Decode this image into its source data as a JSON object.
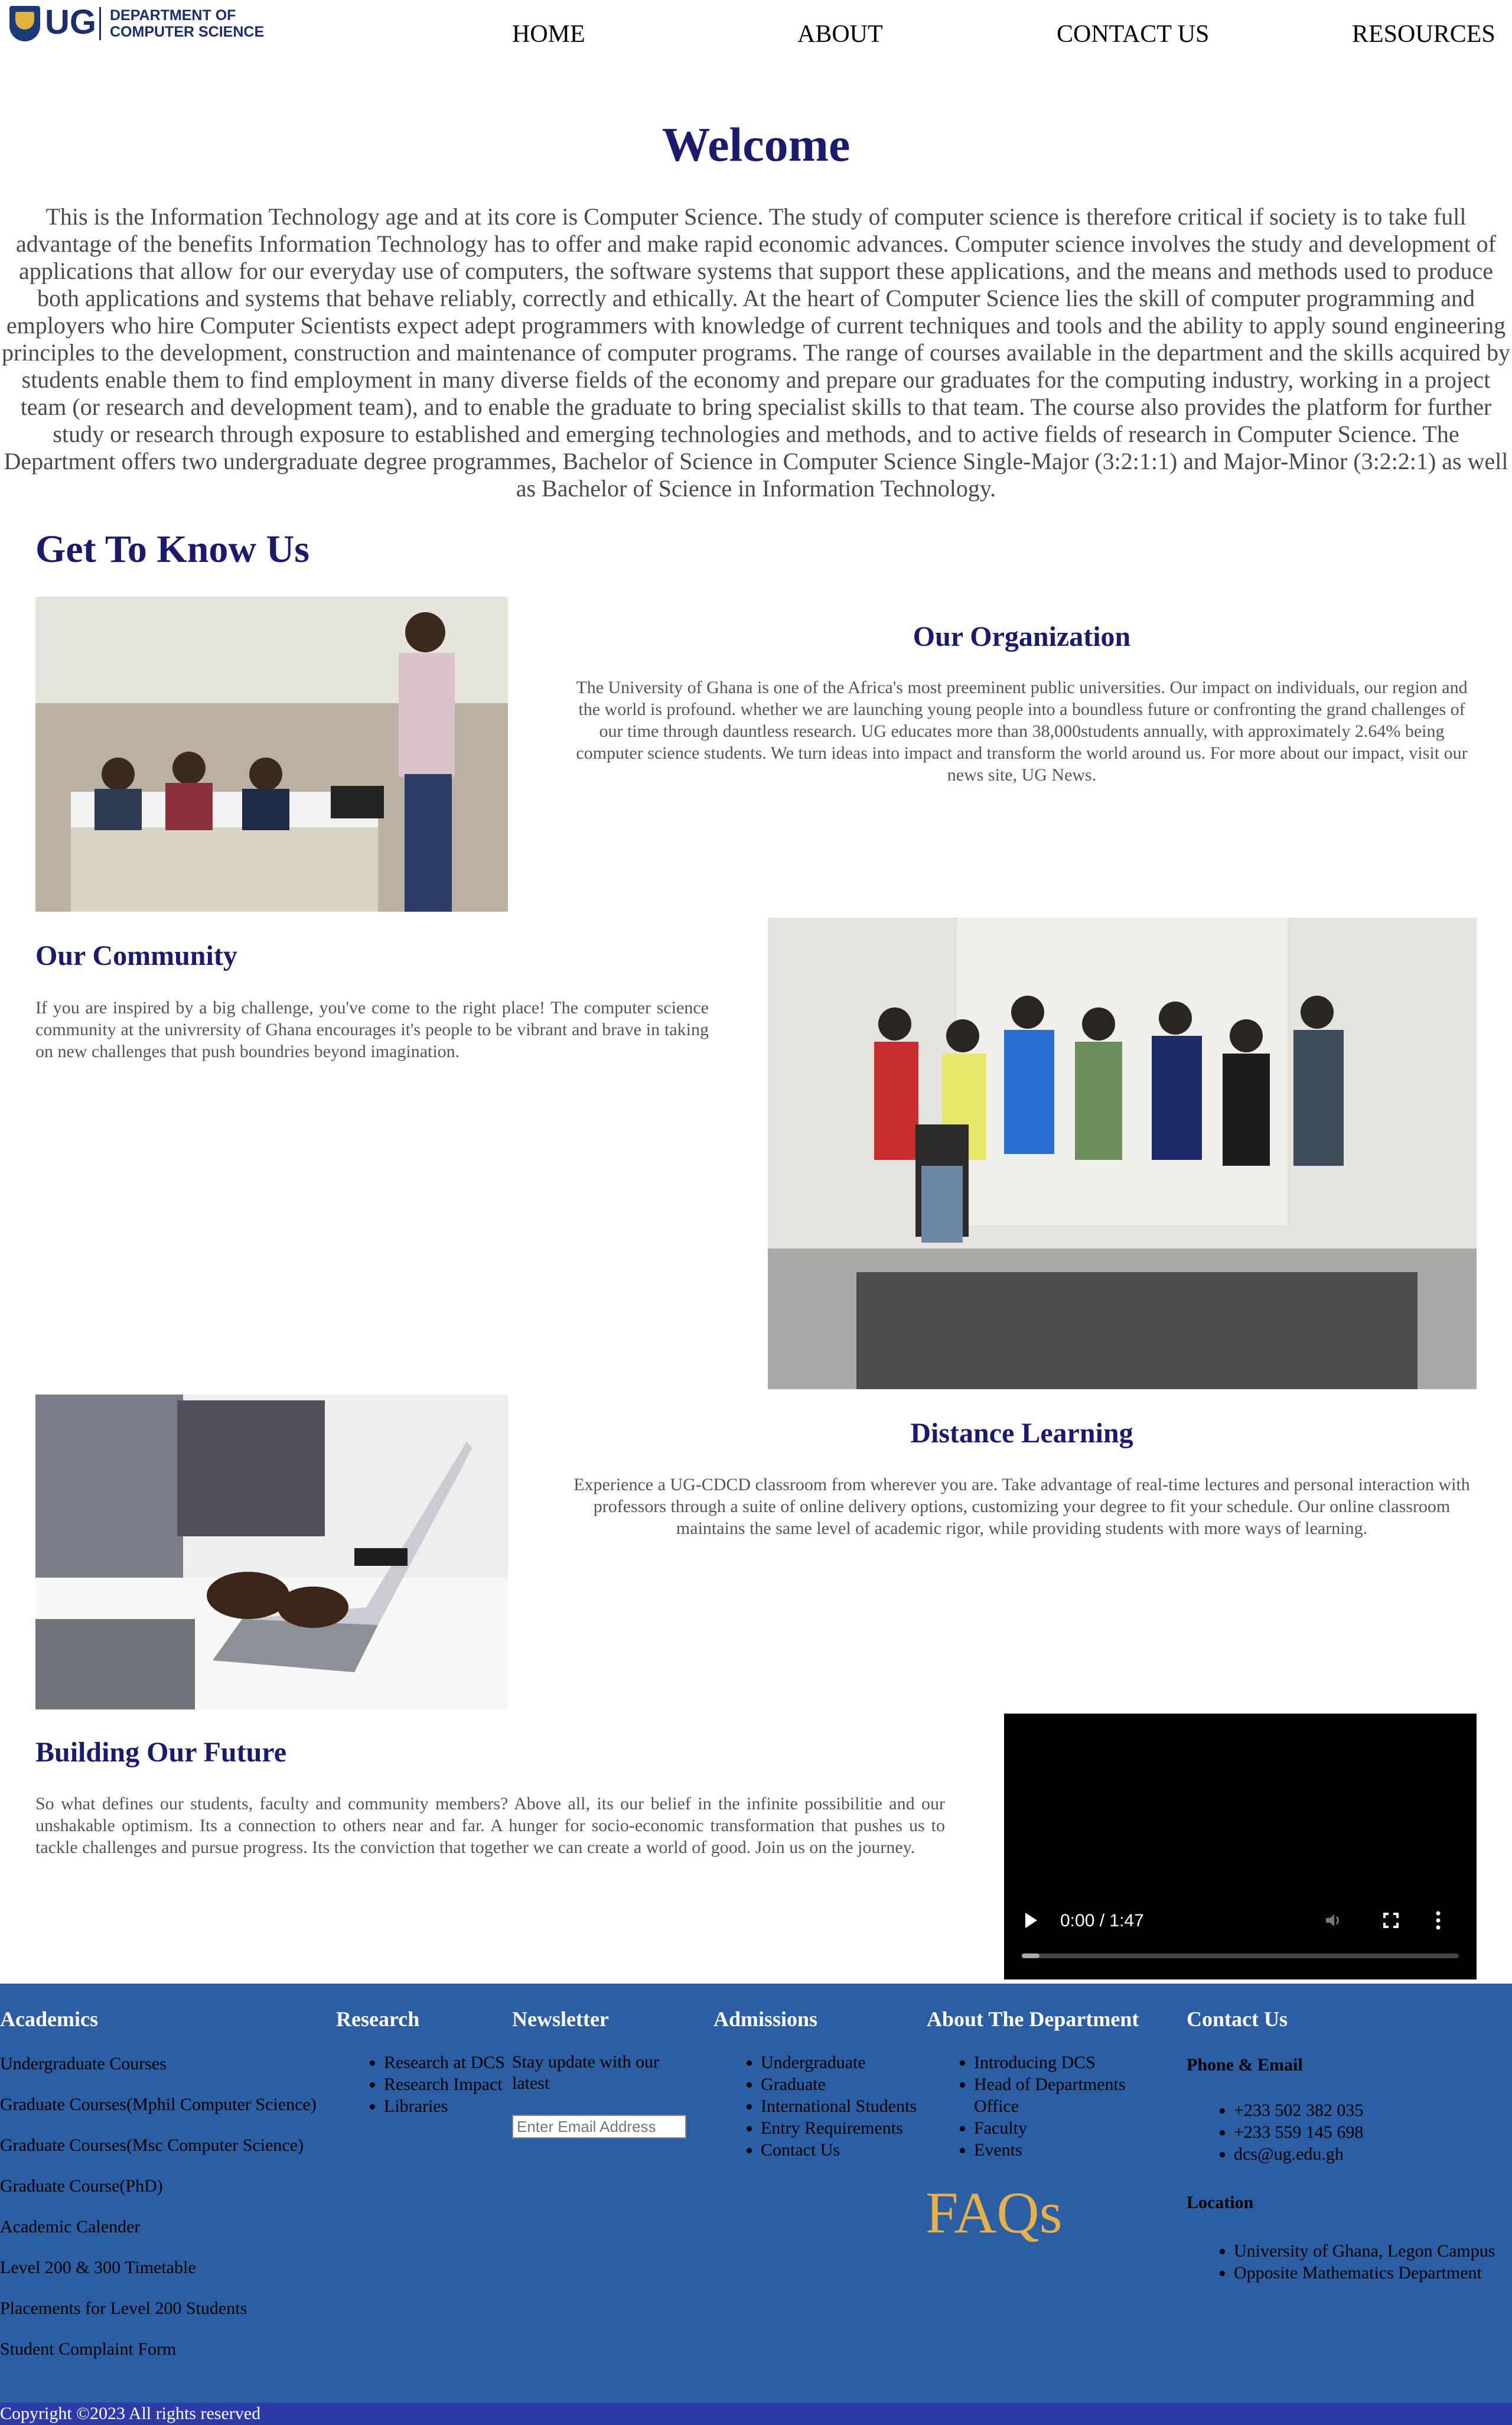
{
  "header": {
    "logo_ug": "UG",
    "logo_dept_line1": "DEPARTMENT OF",
    "logo_dept_line2": "COMPUTER SCIENCE",
    "nav": [
      "HOME",
      "ABOUT",
      "CONTACT US",
      "RESOURCES"
    ]
  },
  "welcome": {
    "title": "Welcome",
    "text": "This is the Information Technology age and at its core is Computer Science. The study of computer science is therefore critical if society is to take full advantage of the benefits Information Technology has to offer and make rapid economic advances. Computer science involves the study and development of applications that allow for our everyday use of computers, the software systems that support these applications, and the means and methods used to produce both applications and systems that behave reliably, correctly and ethically. At the heart of Computer Science lies the skill of computer programming and employers who hire Computer Scientists expect adept programmers with knowledge of current techniques and tools and the ability to apply sound engineering principles to the development, construction and maintenance of computer programs. The range of courses available in the department and the skills acquired by students enable them to find employment in many diverse fields of the economy and prepare our graduates for the computing industry, working in a project team (or research and development team), and to enable the graduate to bring specialist skills to that team. The course also provides the platform for further study or research through exposure to established and emerging technologies and methods, and to active fields of research in Computer Science. The Department offers two undergraduate degree programmes, Bachelor of Science in Computer Science Single-Major (3:2:1:1) and Major-Minor (3:2:2:1) as well as Bachelor of Science in Information Technology."
  },
  "get_to_know": {
    "title": "Get To Know Us",
    "organization": {
      "title": "Our Organization",
      "text": "The University of Ghana is one of the Africa's most preeminent public universities. Our impact on individuals, our region and the world is profound. whether we are launching young people into a boundless future or confronting the grand challenges of our time through dauntless research. UG educates more than 38,000students annually, with approximately 2.64% being computer science students. We turn ideas into impact and transform the world around us. For more about our impact, visit our news site, UG News."
    },
    "community": {
      "title": "Our Community",
      "text": "If you are inspired by a big challenge, you've come to the right place! The computer science community at the univrersity of Ghana encourages it's people to be vibrant and brave in taking on new challenges that push boundries beyond imagination."
    },
    "distance": {
      "title": "Distance Learning",
      "text": "Experience a UG-CDCD classroom from wherever you are. Take advantage of real-time lectures and personal interaction with professors through a suite of online delivery options, customizing your degree to fit your schedule. Our online classroom maintains the same level of academic rigor, while providing students with more ways of learning."
    },
    "future": {
      "title": "Building Our Future",
      "text": "So what defines our students, faculty and community members? Above all, its our belief in the infinite possibilitie and our unshakable optimism. Its a connection to others near and far. A hunger for socio-economic transformation that pushes us to tackle challenges and pursue progress. Its the conviction that together we can create a world of good. Join us on the journey."
    },
    "video": {
      "time": "0:00 / 1:47"
    }
  },
  "footer": {
    "academics": {
      "title": "Academics",
      "links": [
        "Undergraduate Courses",
        "Graduate Courses(Mphil Computer Science)",
        "Graduate Courses(Msc Computer Science)",
        "Graduate Course(PhD)",
        "Academic Calender",
        "Level 200 & 300 Timetable",
        "Placements for Level 200 Students",
        "Student Complaint Form"
      ]
    },
    "research": {
      "title": "Research",
      "links": [
        "Research at DCS",
        "Research Impact",
        "Libraries"
      ]
    },
    "newsletter": {
      "title": "Newsletter",
      "text": "Stay update with our latest",
      "placeholder": "Enter Email Address"
    },
    "admissions": {
      "title": "Admissions",
      "links": [
        "Undergraduate",
        "Graduate",
        "International Students",
        "Entry Requirements",
        "Contact Us"
      ]
    },
    "about": {
      "title": "About The Department",
      "links": [
        "Introducing DCS",
        "Head of Departments Office",
        "Faculty",
        "Events"
      ],
      "faqs": "FAQs"
    },
    "contact": {
      "title": "Contact Us",
      "phone_email_title": "Phone & Email",
      "phone_email": [
        "+233 502 382 035",
        "+233 559 145 698",
        "dcs@ug.edu.gh"
      ],
      "location_title": "Location",
      "location": [
        "University of Ghana, Legon Campus",
        "Opposite Mathematics Department"
      ]
    },
    "copyright": "Copyright ©2023 All rights reserved"
  },
  "colors": {
    "heading": "#1a1a6e",
    "footer_bg": "#2b5ea3",
    "copyright_bg": "#2e3aa8",
    "faqs": "#e8b04a"
  }
}
